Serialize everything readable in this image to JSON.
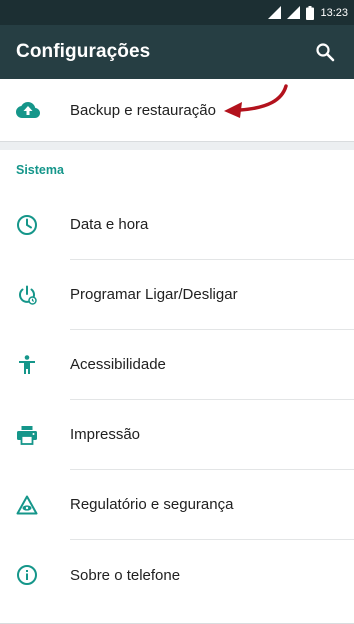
{
  "status_bar": {
    "time": "13:23",
    "icons": [
      "signal-icon",
      "signal-icon",
      "battery-icon"
    ]
  },
  "toolbar": {
    "title": "Configurações",
    "search_icon": "search-icon"
  },
  "top_items": [
    {
      "label": "Backup e restauração",
      "icon": "cloud-upload-icon"
    }
  ],
  "section": {
    "title": "Sistema"
  },
  "system_items": [
    {
      "label": "Data e hora",
      "icon": "clock-icon"
    },
    {
      "label": "Programar Ligar/Desligar",
      "icon": "power-schedule-icon"
    },
    {
      "label": "Acessibilidade",
      "icon": "accessibility-icon"
    },
    {
      "label": "Impressão",
      "icon": "printer-icon"
    },
    {
      "label": "Regulatório e segurança",
      "icon": "regulatory-icon"
    },
    {
      "label": "Sobre o telefone",
      "icon": "info-icon"
    }
  ],
  "colors": {
    "accent": "#15968a",
    "toolbar": "#263e43",
    "status_bar": "#1c2f33",
    "annotation_arrow": "#b3121d"
  }
}
